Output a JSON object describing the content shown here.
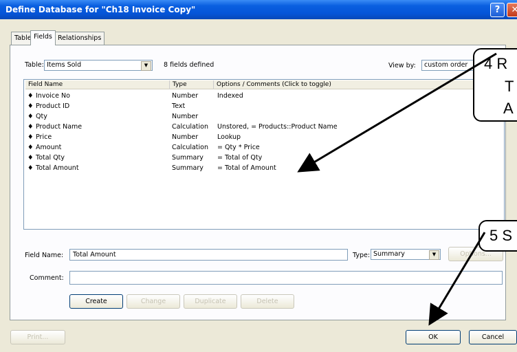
{
  "window": {
    "title": "Define Database for \"Ch18 Invoice Copy\"",
    "help": "?",
    "close": "✕"
  },
  "tabs": [
    {
      "label": "Tables"
    },
    {
      "label": "Fields"
    },
    {
      "label": "Relationships"
    }
  ],
  "table_selector": {
    "label": "Table:",
    "value": "Items Sold",
    "fields_count": "8 fields defined"
  },
  "view_by": {
    "label": "View by:",
    "value": "custom order"
  },
  "columns": {
    "name": "Field Name",
    "type": "Type",
    "options": "Options / Comments   (Click to toggle)"
  },
  "rows": [
    {
      "name": "Invoice No",
      "type": "Number",
      "options": "Indexed"
    },
    {
      "name": "Product ID",
      "type": "Text",
      "options": ""
    },
    {
      "name": "Qty",
      "type": "Number",
      "options": ""
    },
    {
      "name": "Product Name",
      "type": "Calculation",
      "options": "Unstored, = Products::Product Name"
    },
    {
      "name": "Price",
      "type": "Number",
      "options": "Lookup"
    },
    {
      "name": "Amount",
      "type": "Calculation",
      "options": "= Qty * Price"
    },
    {
      "name": "Total Qty",
      "type": "Summary",
      "options": "= Total of Qty"
    },
    {
      "name": "Total Amount",
      "type": "Summary",
      "options": "= Total of Amount"
    }
  ],
  "field_name": {
    "label": "Field Name:",
    "value": "Total Amount"
  },
  "type": {
    "label": "Type:",
    "value": "Summary"
  },
  "options_button": "Options...",
  "comment": {
    "label": "Comment:",
    "value": ""
  },
  "actions": {
    "create": "Create",
    "change": "Change",
    "duplicate": "Duplicate",
    "delete": "Delete"
  },
  "footer": {
    "print": "Print...",
    "ok": "OK",
    "cancel": "Cancel"
  },
  "callouts": {
    "step4": {
      "line1": "4 R",
      "line2": "T",
      "line3": "A"
    },
    "step5": {
      "line1": "5 S"
    }
  }
}
